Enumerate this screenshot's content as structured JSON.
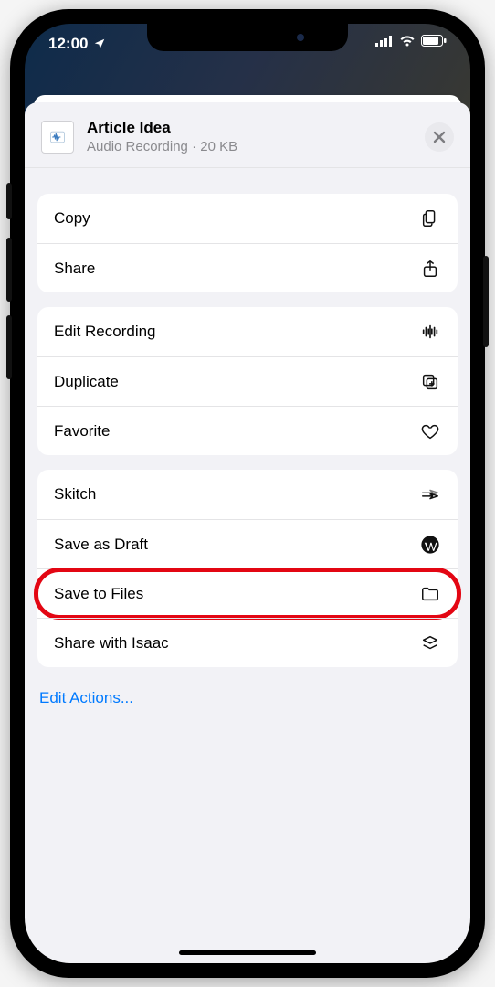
{
  "status": {
    "time": "12:00"
  },
  "header": {
    "title": "Article Idea",
    "subtitle": "Audio Recording · 20 KB"
  },
  "actions": {
    "g1": [
      {
        "label": "Copy"
      },
      {
        "label": "Share"
      }
    ],
    "g2": [
      {
        "label": "Edit Recording"
      },
      {
        "label": "Duplicate"
      },
      {
        "label": "Favorite"
      }
    ],
    "g3": [
      {
        "label": "Skitch"
      },
      {
        "label": "Save as Draft"
      },
      {
        "label": "Save to Files"
      },
      {
        "label": "Share with Isaac"
      }
    ]
  },
  "edit_actions_label": "Edit Actions..."
}
